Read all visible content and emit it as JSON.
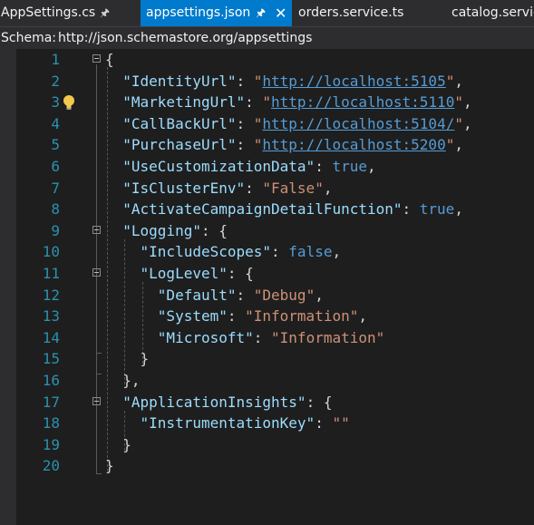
{
  "tabs": [
    {
      "label": "AppSettings.cs",
      "pinned": true,
      "active": false
    },
    {
      "label": "appsettings.json",
      "pinned": true,
      "active": true,
      "closable": true
    },
    {
      "label": "orders.service.ts",
      "pinned": false,
      "active": false
    },
    {
      "label": "catalog.service",
      "pinned": false,
      "active": false
    }
  ],
  "icons": {
    "pin": "pin-icon",
    "close": "close-icon",
    "lightbulb": "lightbulb-icon",
    "fold": "collapse-toggle-icon"
  },
  "schema": {
    "label": "Schema:",
    "url": "http://json.schemastore.org/appsettings"
  },
  "colors": {
    "key": "#9cdcfe",
    "string": "#ce9178",
    "link": "#569cd6",
    "keyword": "#569cd6",
    "punctuation": "#d4d4d4",
    "line_number": "#2b91af",
    "active_tab": "#007acc",
    "editor_bg": "#1e1e1e"
  },
  "code_lines": [
    {
      "n": "1",
      "t": [
        [
          "p",
          "{"
        ]
      ]
    },
    {
      "n": "2",
      "t": [
        [
          "p",
          "  "
        ],
        [
          "k",
          "\"IdentityUrl\""
        ],
        [
          "p",
          ": "
        ],
        [
          "s",
          "\""
        ],
        [
          "u",
          "http://localhost:5105"
        ],
        [
          "s",
          "\""
        ],
        [
          "p",
          ","
        ]
      ]
    },
    {
      "n": "3",
      "t": [
        [
          "p",
          "  "
        ],
        [
          "k",
          "\"MarketingUrl\""
        ],
        [
          "p",
          ": "
        ],
        [
          "s",
          "\""
        ],
        [
          "u",
          "http://localhost:5110"
        ],
        [
          "s",
          "\""
        ],
        [
          "p",
          ","
        ]
      ]
    },
    {
      "n": "4",
      "t": [
        [
          "p",
          "  "
        ],
        [
          "k",
          "\"CallBackUrl\""
        ],
        [
          "p",
          ": "
        ],
        [
          "s",
          "\""
        ],
        [
          "u",
          "http://localhost:5104/"
        ],
        [
          "s",
          "\""
        ],
        [
          "p",
          ","
        ]
      ]
    },
    {
      "n": "5",
      "t": [
        [
          "p",
          "  "
        ],
        [
          "k",
          "\"PurchaseUrl\""
        ],
        [
          "p",
          ": "
        ],
        [
          "s",
          "\""
        ],
        [
          "u",
          "http://localhost:5200"
        ],
        [
          "s",
          "\""
        ],
        [
          "p",
          ","
        ]
      ]
    },
    {
      "n": "6",
      "t": [
        [
          "p",
          "  "
        ],
        [
          "k",
          "\"UseCustomizationData\""
        ],
        [
          "p",
          ": "
        ],
        [
          "b",
          "true"
        ],
        [
          "p",
          ","
        ]
      ]
    },
    {
      "n": "7",
      "t": [
        [
          "p",
          "  "
        ],
        [
          "k",
          "\"IsClusterEnv\""
        ],
        [
          "p",
          ": "
        ],
        [
          "s",
          "\"False\""
        ],
        [
          "p",
          ","
        ]
      ]
    },
    {
      "n": "8",
      "t": [
        [
          "p",
          "  "
        ],
        [
          "k",
          "\"ActivateCampaignDetailFunction\""
        ],
        [
          "p",
          ": "
        ],
        [
          "b",
          "true"
        ],
        [
          "p",
          ","
        ]
      ]
    },
    {
      "n": "9",
      "t": [
        [
          "p",
          "  "
        ],
        [
          "k",
          "\"Logging\""
        ],
        [
          "p",
          ": {"
        ]
      ]
    },
    {
      "n": "10",
      "t": [
        [
          "p",
          "    "
        ],
        [
          "k",
          "\"IncludeScopes\""
        ],
        [
          "p",
          ": "
        ],
        [
          "b",
          "false"
        ],
        [
          "p",
          ","
        ]
      ]
    },
    {
      "n": "11",
      "t": [
        [
          "p",
          "    "
        ],
        [
          "k",
          "\"LogLevel\""
        ],
        [
          "p",
          ": {"
        ]
      ]
    },
    {
      "n": "12",
      "t": [
        [
          "p",
          "      "
        ],
        [
          "k",
          "\"Default\""
        ],
        [
          "p",
          ": "
        ],
        [
          "s",
          "\"Debug\""
        ],
        [
          "p",
          ","
        ]
      ]
    },
    {
      "n": "13",
      "t": [
        [
          "p",
          "      "
        ],
        [
          "k",
          "\"System\""
        ],
        [
          "p",
          ": "
        ],
        [
          "s",
          "\"Information\""
        ],
        [
          "p",
          ","
        ]
      ]
    },
    {
      "n": "14",
      "t": [
        [
          "p",
          "      "
        ],
        [
          "k",
          "\"Microsoft\""
        ],
        [
          "p",
          ": "
        ],
        [
          "s",
          "\"Information\""
        ]
      ]
    },
    {
      "n": "15",
      "t": [
        [
          "p",
          "    }"
        ]
      ]
    },
    {
      "n": "16",
      "t": [
        [
          "p",
          "  },"
        ]
      ]
    },
    {
      "n": "17",
      "t": [
        [
          "p",
          "  "
        ],
        [
          "k",
          "\"ApplicationInsights\""
        ],
        [
          "p",
          ": {"
        ]
      ]
    },
    {
      "n": "18",
      "t": [
        [
          "p",
          "    "
        ],
        [
          "k",
          "\"InstrumentationKey\""
        ],
        [
          "p",
          ": "
        ],
        [
          "s",
          "\"\""
        ]
      ]
    },
    {
      "n": "19",
      "t": [
        [
          "p",
          "  }"
        ]
      ]
    },
    {
      "n": "20",
      "t": [
        [
          "p",
          "}"
        ]
      ]
    }
  ]
}
